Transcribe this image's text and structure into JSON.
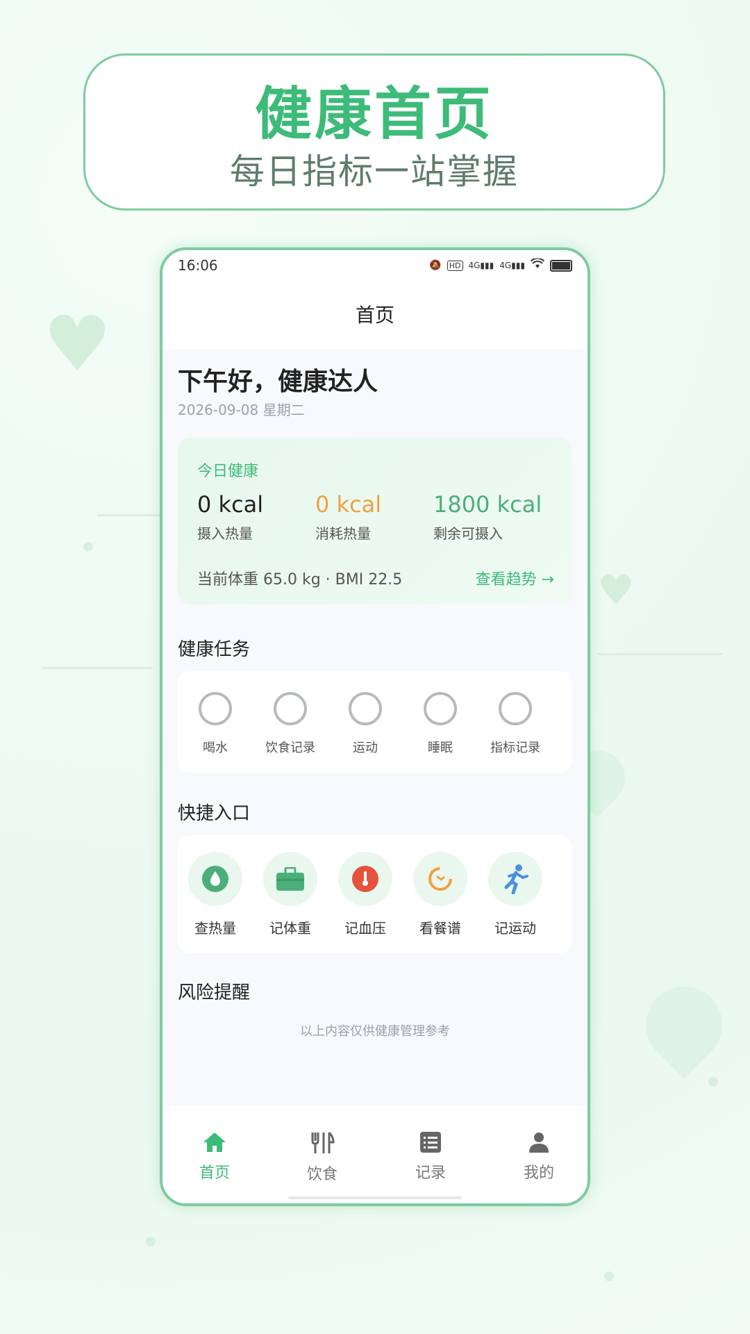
{
  "colors": {
    "brand": "#3dbb78",
    "accent_orange": "#f0a040",
    "accent_green": "#4caf7a",
    "red": "#e5533d",
    "blue": "#4a8fe2"
  },
  "banner": {
    "title": "健康首页",
    "subtitle": "每日指标一站掌握"
  },
  "status_bar": {
    "time": "16:06",
    "icons": [
      "mute-icon",
      "hd-icon",
      "signal-4g-icon",
      "signal-4g-icon",
      "wifi-icon",
      "battery-icon"
    ]
  },
  "header": {
    "title": "首页"
  },
  "greeting": {
    "text": "下午好，健康达人",
    "date": "2026-09-08 星期二"
  },
  "today": {
    "title": "今日健康",
    "metrics": [
      {
        "value": "0 kcal",
        "label": "摄入热量"
      },
      {
        "value": "0 kcal",
        "label": "消耗热量"
      },
      {
        "value": "1800 kcal",
        "label": "剩余可摄入"
      }
    ],
    "footer": "当前体重 65.0 kg · BMI 22.5",
    "link": "查看趋势 →"
  },
  "tasks": {
    "title": "健康任务",
    "items": [
      {
        "label": "喝水"
      },
      {
        "label": "饮食记录"
      },
      {
        "label": "运动"
      },
      {
        "label": "睡眠"
      },
      {
        "label": "指标记录"
      }
    ]
  },
  "quick": {
    "title": "快捷入口",
    "items": [
      {
        "label": "查热量",
        "icon": "drop-icon"
      },
      {
        "label": "记体重",
        "icon": "briefcase-icon"
      },
      {
        "label": "记血压",
        "icon": "thermometer-icon"
      },
      {
        "label": "看餐谱",
        "icon": "refresh-icon"
      },
      {
        "label": "记运动",
        "icon": "running-icon"
      }
    ]
  },
  "risk": {
    "title": "风险提醒",
    "note": "以上内容仅供健康管理参考"
  },
  "tabbar": {
    "items": [
      {
        "label": "首页",
        "icon": "home-icon",
        "active": true
      },
      {
        "label": "饮食",
        "icon": "fork-icon"
      },
      {
        "label": "记录",
        "icon": "list-icon"
      },
      {
        "label": "我的",
        "icon": "user-icon"
      }
    ]
  }
}
